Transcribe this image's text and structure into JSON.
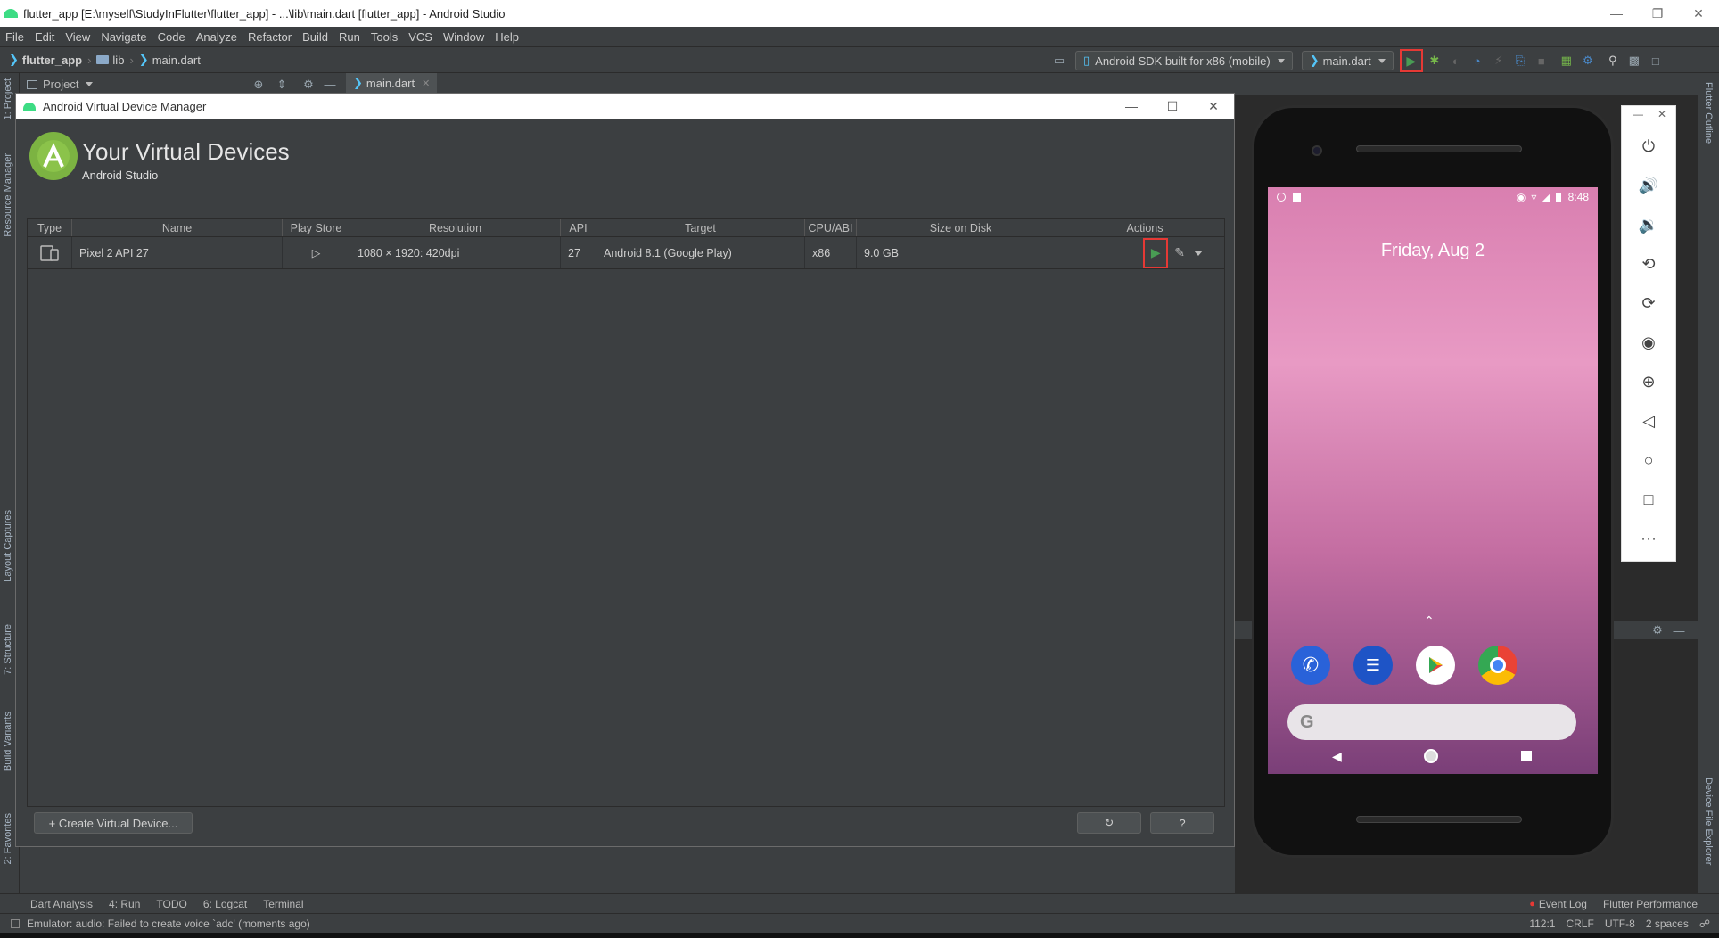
{
  "window": {
    "title": "flutter_app [E:\\myself\\StudyInFlutter\\flutter_app] - ...\\lib\\main.dart [flutter_app] - Android Studio"
  },
  "menu": [
    "File",
    "Edit",
    "View",
    "Navigate",
    "Code",
    "Analyze",
    "Refactor",
    "Build",
    "Run",
    "Tools",
    "VCS",
    "Window",
    "Help"
  ],
  "breadcrumb": {
    "project": "flutter_app",
    "folder": "lib",
    "file": "main.dart"
  },
  "toolbar": {
    "device_combo": "Android SDK built for x86 (mobile)",
    "config_combo": "main.dart"
  },
  "project_panel": {
    "label": "Project",
    "editor_tab": "main.dart"
  },
  "left_tabs": [
    "1: Project",
    "Resource Manager",
    "Layout Captures",
    "7: Structure",
    "Build Variants",
    "2: Favorites"
  ],
  "right_tabs": [
    "Flutter Outline",
    "Device File Explorer"
  ],
  "avd": {
    "window_title": "Android Virtual Device Manager",
    "heading": "Your Virtual Devices",
    "subheading": "Android Studio",
    "columns": [
      "Type",
      "Name",
      "Play Store",
      "Resolution",
      "API",
      "Target",
      "CPU/ABI",
      "Size on Disk",
      "Actions"
    ],
    "rows": [
      {
        "name": "Pixel 2 API 27",
        "resolution": "1080 × 1920: 420dpi",
        "api": "27",
        "target": "Android 8.1 (Google Play)",
        "cpu": "x86",
        "size": "9.0 GB"
      }
    ],
    "create_button": "+ Create Virtual Device...",
    "help_button": "?"
  },
  "emulator": {
    "time": "8:48",
    "date": "Friday, Aug 2",
    "search_letter": "G"
  },
  "bottom_tools": [
    "Dart Analysis",
    "4: Run",
    "TODO",
    "6: Logcat",
    "Terminal"
  ],
  "bottom_right_tools": [
    "Event Log",
    "Flutter Performance"
  ],
  "status": {
    "message": "Emulator: audio: Failed to create voice `adc' (moments ago)",
    "position": "112:1",
    "line_sep": "CRLF",
    "encoding": "UTF-8",
    "indent": "2 spaces"
  },
  "colors": {
    "run_green": "#499c54",
    "highlight_red": "#e53935",
    "accent_blue": "#4a88c7"
  }
}
